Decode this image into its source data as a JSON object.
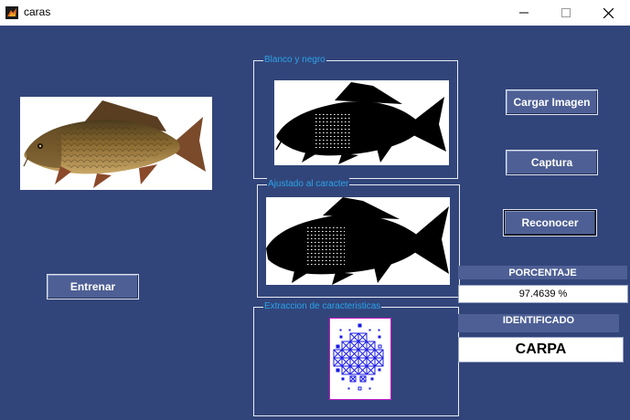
{
  "window": {
    "title": "caras",
    "controls": [
      "minimize",
      "maximize",
      "close"
    ]
  },
  "panels": {
    "bw_title": "Blanco y negro",
    "adjusted_title": "Ajustado al caracter",
    "extraction_title": "Extraccion de caracteristicas"
  },
  "buttons": {
    "load_image": "Cargar Imagen",
    "capture": "Captura",
    "recognize": "Reconocer",
    "train": "Entrenar"
  },
  "results": {
    "percentage_label": "PORCENTAJE",
    "percentage_value": "97.4639 %",
    "identified_label": "IDENTIFICADO",
    "identified_value": "CARPA"
  },
  "colors": {
    "background": "#32457a",
    "panel_title": "#2aa3e8",
    "button": "#4d5f94",
    "feature_grid": "#1a1ae6",
    "grid_border": "#c81ec8"
  }
}
